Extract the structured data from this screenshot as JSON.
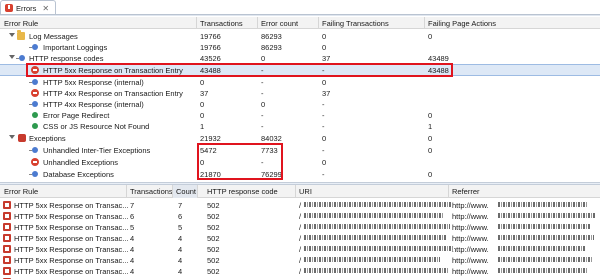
{
  "view": {
    "tab_title": "Errors",
    "close_glyph": "✕"
  },
  "top_table": {
    "columns": [
      "Error Rule",
      "Transactions",
      "Error count",
      "Failing Transactions",
      "Failing Page Actions"
    ],
    "rows": [
      {
        "label": "Log Messages",
        "icon": "folder-icon",
        "transactions": "19766",
        "error_count": "86293",
        "failing_tx": "0",
        "failing_pa": "0"
      },
      {
        "label": "Important Loggings",
        "icon": "rule-icon",
        "transactions": "19766",
        "error_count": "86293",
        "failing_tx": "0",
        "failing_pa": ""
      },
      {
        "label": "HTTP response codes",
        "icon": "http-rule-icon",
        "transactions": "43526",
        "error_count": "0",
        "failing_tx": "37",
        "failing_pa": "43489"
      },
      {
        "label": "HTTP 5xx Response on Transaction Entry",
        "icon": "error-icon",
        "transactions": "43488",
        "error_count": "-",
        "failing_tx": "-",
        "failing_pa": "43488"
      },
      {
        "label": "HTTP 5xx Response (internal)",
        "icon": "rule-icon",
        "transactions": "0",
        "error_count": "-",
        "failing_tx": "0",
        "failing_pa": ""
      },
      {
        "label": "HTTP 4xx Response on Transaction Entry",
        "icon": "error-icon",
        "transactions": "37",
        "error_count": "-",
        "failing_tx": "37",
        "failing_pa": ""
      },
      {
        "label": "HTTP 4xx Response (internal)",
        "icon": "rule-icon",
        "transactions": "0",
        "error_count": "0",
        "failing_tx": "-",
        "failing_pa": ""
      },
      {
        "label": "Error Page Redirect",
        "icon": "ok-icon",
        "transactions": "0",
        "error_count": "-",
        "failing_tx": "-",
        "failing_pa": "0"
      },
      {
        "label": "CSS or JS Resource Not Found",
        "icon": "ok-icon",
        "transactions": "1",
        "error_count": "-",
        "failing_tx": "-",
        "failing_pa": "1"
      },
      {
        "label": "Exceptions",
        "icon": "exceptions-icon",
        "transactions": "21932",
        "error_count": "84032",
        "failing_tx": "0",
        "failing_pa": "0"
      },
      {
        "label": "Unhandled Inter-Tier Exceptions",
        "icon": "rule-icon",
        "transactions": "5472",
        "error_count": "7733",
        "failing_tx": "-",
        "failing_pa": "0"
      },
      {
        "label": "Unhandled Exceptions",
        "icon": "error-icon",
        "transactions": "0",
        "error_count": "-",
        "failing_tx": "0",
        "failing_pa": ""
      },
      {
        "label": "Database Exceptions",
        "icon": "rule-icon",
        "transactions": "21870",
        "error_count": "76299",
        "failing_tx": "-",
        "failing_pa": "0"
      }
    ]
  },
  "bottom_table": {
    "columns": [
      "Error Rule",
      "Transactions",
      "Count",
      "HTTP response code",
      "URI",
      "Referrer"
    ],
    "rows": [
      {
        "rule": "HTTP 5xx Response on Transac...",
        "transactions": "7",
        "count": "7",
        "code": "502",
        "uri": "/",
        "referrer": "http://www."
      },
      {
        "rule": "HTTP 5xx Response on Transac...",
        "transactions": "6",
        "count": "6",
        "code": "502",
        "uri": "/",
        "referrer": "http://www."
      },
      {
        "rule": "HTTP 5xx Response on Transac...",
        "transactions": "5",
        "count": "5",
        "code": "502",
        "uri": "/",
        "referrer": "http://www."
      },
      {
        "rule": "HTTP 5xx Response on Transac...",
        "transactions": "4",
        "count": "4",
        "code": "502",
        "uri": "/",
        "referrer": "http://www."
      },
      {
        "rule": "HTTP 5xx Response on Transac...",
        "transactions": "4",
        "count": "4",
        "code": "502",
        "uri": "/",
        "referrer": "http://www."
      },
      {
        "rule": "HTTP 5xx Response on Transac...",
        "transactions": "4",
        "count": "4",
        "code": "502",
        "uri": "/",
        "referrer": "http://www."
      },
      {
        "rule": "HTTP 5xx Response on Transac...",
        "transactions": "4",
        "count": "4",
        "code": "502",
        "uri": "/",
        "referrer": "http://www."
      },
      {
        "rule": "HTTP 5xx Response on Transac...",
        "transactions": "4",
        "count": "4",
        "code": "502",
        "uri": "/",
        "referrer": "http://www."
      }
    ]
  },
  "colors": {
    "highlight": "#e0141e",
    "selection": "#dde8f6",
    "error_icon": "#d8402f"
  }
}
